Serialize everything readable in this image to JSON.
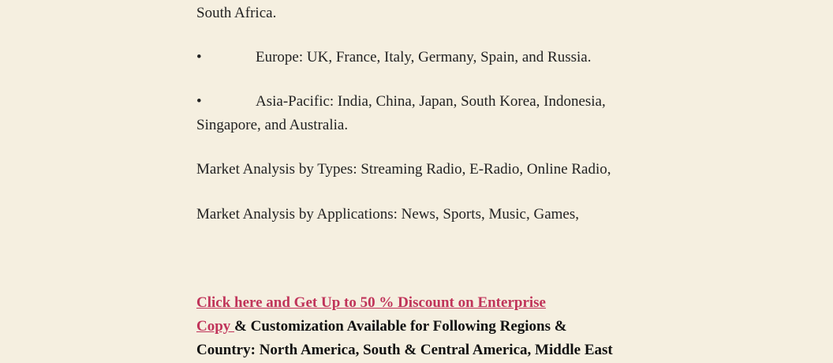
{
  "body": {
    "line_south_africa": "South Africa.",
    "europe": {
      "bullet": "•",
      "text": "Europe: UK, France, Italy, Germany, Spain, and Russia."
    },
    "asia_pacific": {
      "bullet": "•",
      "text_line1": "Asia-Pacific: India, China, Japan, South Korea, Indonesia,",
      "text_line2": "Singapore, and Australia."
    },
    "types": "Market Analysis by Types: Streaming Radio, E-Radio, Online Radio,",
    "applications": "Market Analysis by Applications: News, Sports, Music, Games,"
  },
  "cta": {
    "link_line1": "Click here and Get Up to 50 % Discount on Enterprise",
    "link_line2": "Copy ",
    "rest_line2": " & Customization Available for Following Regions &",
    "line3": "Country: North America, South & Central America, Middle East"
  },
  "colors": {
    "background": "#f5efe0",
    "text": "#222222",
    "link": "#c0345a"
  }
}
